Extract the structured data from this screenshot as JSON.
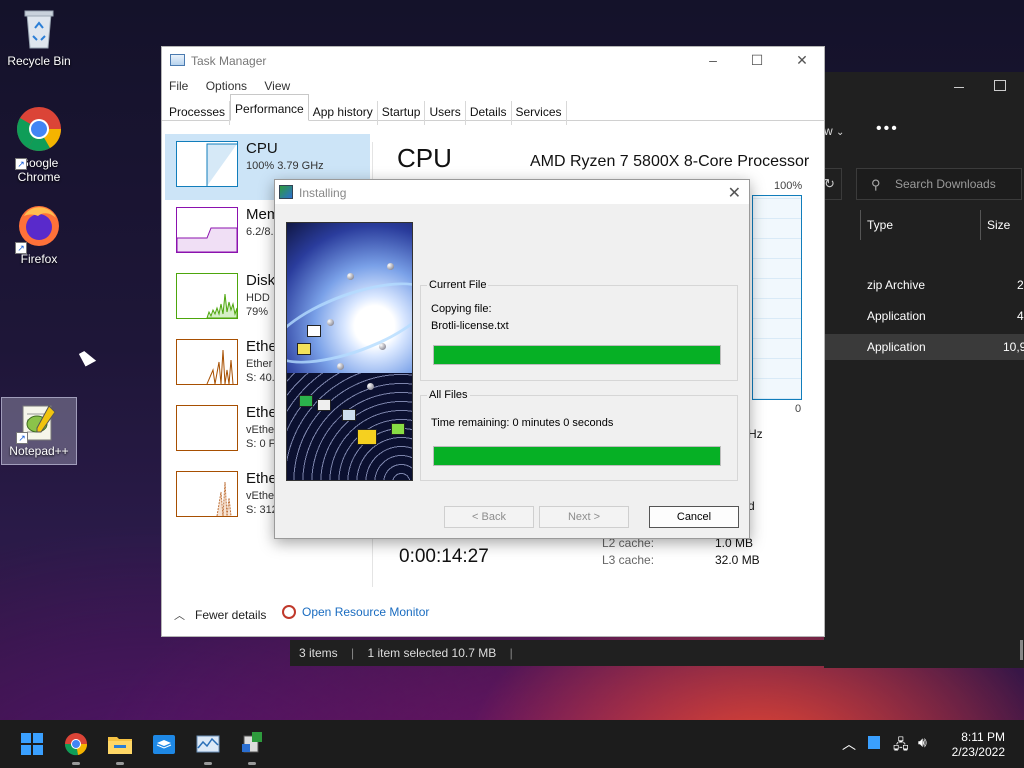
{
  "desktop": {
    "icons": [
      {
        "label": "Recycle Bin"
      },
      {
        "label": "Google Chrome"
      },
      {
        "label": "Firefox"
      },
      {
        "label": "Notepad++"
      }
    ]
  },
  "explorer": {
    "view_label": "w",
    "more_label": "•••",
    "search_placeholder": "Search Downloads",
    "headers": {
      "type": "Type",
      "size": "Size"
    },
    "rows": [
      {
        "type": "zip Archive",
        "size": "2"
      },
      {
        "type": "Application",
        "size": "4"
      },
      {
        "type": "Application",
        "size": "10,9"
      }
    ],
    "status": {
      "items": "3 items",
      "selected": "1 item selected  10.7 MB"
    }
  },
  "task_manager": {
    "title": "Task Manager",
    "menu": [
      "File",
      "Options",
      "View"
    ],
    "tabs": [
      "Processes",
      "Performance",
      "App history",
      "Startup",
      "Users",
      "Details",
      "Services"
    ],
    "active_tab": "Performance",
    "sidebar": [
      {
        "name": "CPU",
        "line1": "100%  3.79 GHz",
        "line2": ""
      },
      {
        "name": "Mem",
        "line1": "6.2/8.",
        "line2": ""
      },
      {
        "name": "Disk",
        "line1": "HDD",
        "line2": "79%"
      },
      {
        "name": "Ethe",
        "line1": "Ether",
        "line2": "S: 40."
      },
      {
        "name": "Ethe",
        "line1": "vEthe",
        "line2": "S: 0 F"
      },
      {
        "name": "Ethe",
        "line1": "vEthe",
        "line2": "S: 312"
      }
    ],
    "heading": "CPU",
    "model": "AMD Ryzen 7 5800X 8-Core Processor",
    "graph_max": "100%",
    "graph_min": "0",
    "ghz_suffix": "Hz",
    "d_suffix": "d",
    "uptime": "0:00:14:27",
    "l2_label": "L2 cache:",
    "l2_value": "1.0 MB",
    "l3_label": "L3 cache:",
    "l3_value": "32.0 MB",
    "fewer_details": "Fewer details",
    "open_resource_monitor": "Open Resource Monitor"
  },
  "installer": {
    "title": "Installing",
    "current_file_group": "Current File",
    "copying_label": "Copying file:",
    "file_name": "Brotli-license.txt",
    "current_progress": 1.0,
    "all_files_group": "All Files",
    "time_remaining": "Time remaining: 0 minutes 0 seconds",
    "all_progress": 1.0,
    "back_button": "< Back",
    "next_button": "Next >",
    "cancel_button": "Cancel",
    "progress_color": "#06b025"
  },
  "taskbar": {
    "time": "8:11 PM",
    "date": "2/23/2022"
  }
}
